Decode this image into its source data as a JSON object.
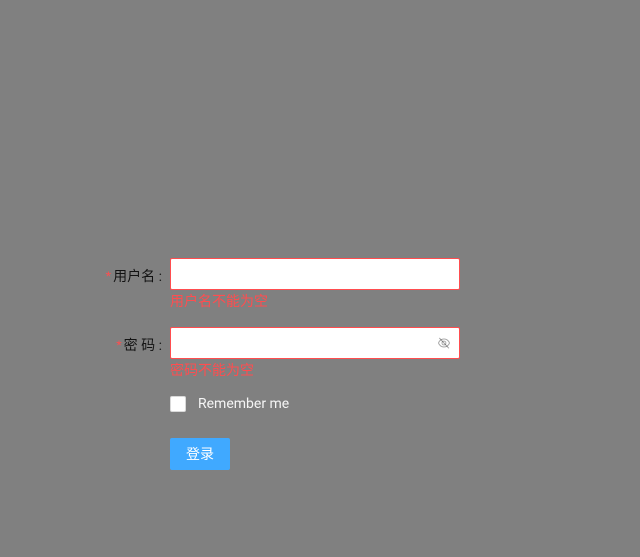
{
  "form": {
    "username": {
      "label": "用户名 :",
      "value": "",
      "error": "用户名不能为空"
    },
    "password": {
      "label": "密 码 :",
      "value": "",
      "error": "密码不能为空"
    },
    "remember": {
      "label": "Remember me",
      "checked": false
    },
    "submit": {
      "label": "登录"
    }
  },
  "colors": {
    "error": "#ff4d4f",
    "primary": "#40a9ff",
    "background": "#808080"
  }
}
